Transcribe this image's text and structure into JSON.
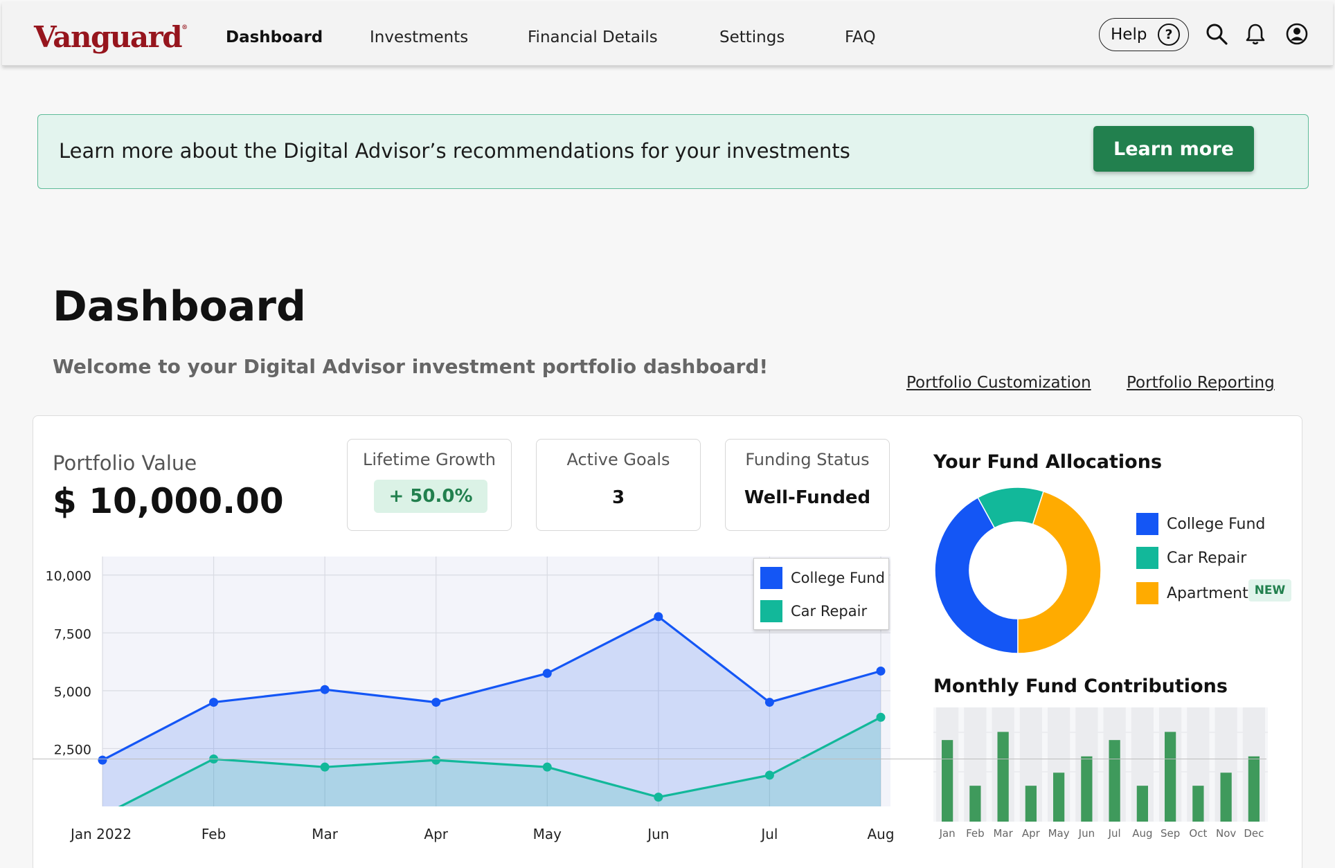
{
  "header": {
    "logo": "Vanguard",
    "nav": [
      "Dashboard",
      "Investments",
      "Financial Details",
      "Settings",
      "FAQ"
    ],
    "active_nav": "Dashboard",
    "help_label": "Help",
    "icons": [
      "search-icon",
      "bell-icon",
      "user-icon"
    ]
  },
  "banner": {
    "text": "Learn more about the Digital Advisor’s recommendations for your investments",
    "button_label": "Learn more",
    "background": "#e3f4ee",
    "button_color": "#22804e"
  },
  "page": {
    "title": "Dashboard",
    "welcome": "Welcome to your Digital Advisor investment portfolio dashboard!",
    "links": [
      "Portfolio Customization",
      "Portfolio Reporting"
    ]
  },
  "summary": {
    "portfolio_value_label": "Portfolio Value",
    "portfolio_value": "$ 10,000.00",
    "stats": [
      {
        "label": "Lifetime Growth",
        "value": "+ 50.0%"
      },
      {
        "label": "Active Goals",
        "value": "3"
      },
      {
        "label": "Funding Status",
        "value": "Well-Funded"
      }
    ]
  },
  "allocations": {
    "title": "Your Fund Allocations",
    "legend": [
      {
        "name": "College Fund",
        "color": "#1456f5"
      },
      {
        "name": "Car Repair",
        "color": "#12b89a"
      },
      {
        "name": "Apartment",
        "color": "#ffab00"
      }
    ],
    "new_badge": "NEW"
  },
  "contributions": {
    "title": "Monthly Fund Contributions"
  },
  "chart_data": [
    {
      "type": "area",
      "x": [
        "Jan 2022",
        "Feb",
        "Mar",
        "Apr",
        "May",
        "Jun",
        "Jul",
        "Aug"
      ],
      "y_ticks": [
        "10,000",
        "7,500",
        "5,000",
        "2,500"
      ],
      "ylim": [
        0,
        10800
      ],
      "grid": true,
      "legend_position": "top-right",
      "series": [
        {
          "name": "College Fund",
          "color": "#1456f5",
          "values": [
            2000,
            4500,
            5050,
            4500,
            5750,
            8200,
            4500,
            5850
          ]
        },
        {
          "name": "Car Repair",
          "color": "#12b89a",
          "values": [
            -400,
            2050,
            1700,
            2000,
            1700,
            400,
            1350,
            3850
          ]
        }
      ]
    },
    {
      "type": "pie",
      "donut": true,
      "labels": [
        "College Fund",
        "Car Repair",
        "Apartment"
      ],
      "values": [
        42,
        13,
        45
      ],
      "colors": [
        "#1456f5",
        "#12b89a",
        "#ffab00"
      ]
    },
    {
      "type": "bar",
      "categories": [
        "Jan",
        "Feb",
        "Mar",
        "Apr",
        "May",
        "Jun",
        "Jul",
        "Aug",
        "Sep",
        "Oct",
        "Nov",
        "Dec"
      ],
      "values": [
        5,
        2.2,
        5.5,
        2.2,
        3,
        4,
        5,
        2.2,
        5.5,
        2.2,
        3,
        4
      ],
      "ylim": [
        0,
        7
      ],
      "color": "#3f9a5c"
    }
  ]
}
